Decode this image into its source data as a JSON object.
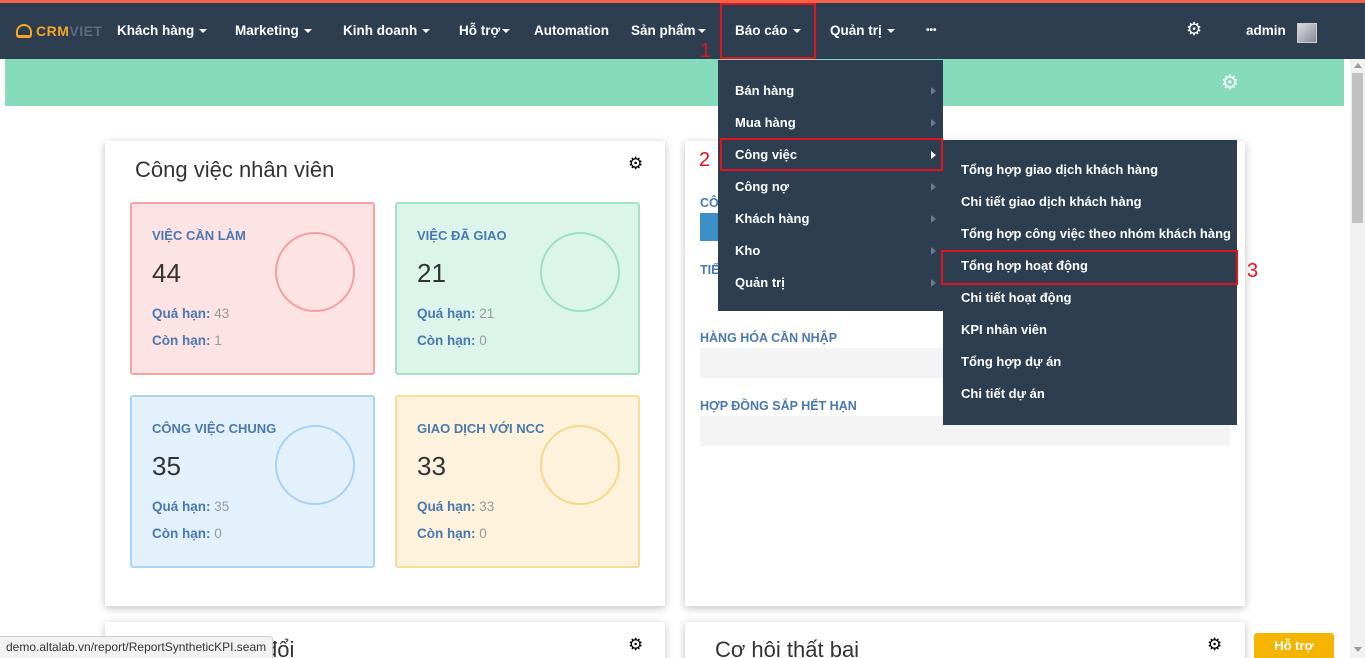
{
  "brand": {
    "logo_part1": "CRM",
    "logo_part2": "VIET"
  },
  "nav": {
    "khach_hang": "Khách hàng",
    "marketing": "Marketing",
    "kinh_doanh": "Kinh doanh",
    "ho_tro": "Hỗ trợ",
    "automation": "Automation",
    "san_pham": "Sản phẩm",
    "bao_cao": "Báo cáo",
    "quan_tri": "Quản trị",
    "more": "•••",
    "user": "admin"
  },
  "report_menu": {
    "items": [
      {
        "label": "Bán hàng"
      },
      {
        "label": "Mua hàng"
      },
      {
        "label": "Công việc"
      },
      {
        "label": "Công nợ"
      },
      {
        "label": "Khách hàng"
      },
      {
        "label": "Kho"
      },
      {
        "label": "Quản trị"
      }
    ]
  },
  "work_submenu": {
    "items": [
      {
        "label": "Tổng hợp giao dịch khách hàng"
      },
      {
        "label": "Chi tiết giao dịch khách hàng"
      },
      {
        "label": "Tổng hợp công việc theo nhóm khách hàng"
      },
      {
        "label": "Tổng hợp hoạt động"
      },
      {
        "label": "Chi tiết hoạt động"
      },
      {
        "label": "KPI nhân viên"
      },
      {
        "label": "Tổng hợp dự án"
      },
      {
        "label": "Chi tiết dự án"
      }
    ]
  },
  "annotations": {
    "step1": "1",
    "step2": "2",
    "step3": "3"
  },
  "work_panel": {
    "title": "Công việc nhân viên",
    "cards": [
      {
        "title": "VIỆC CẦN LÀM",
        "count": "44",
        "overdue_label": "Quá hạn:",
        "overdue": "43",
        "remaining_label": "Còn hạn:",
        "remaining": "1"
      },
      {
        "title": "VIỆC ĐÃ GIAO",
        "count": "21",
        "overdue_label": "Quá hạn:",
        "overdue": "21",
        "remaining_label": "Còn hạn:",
        "remaining": "0"
      },
      {
        "title": "CÔNG VIỆC CHUNG",
        "count": "35",
        "overdue_label": "Quá hạn:",
        "overdue": "35",
        "remaining_label": "Còn hạn:",
        "remaining": "0"
      },
      {
        "title": "GIAO DỊCH VỚI NCC",
        "count": "33",
        "overdue_label": "Quá hạn:",
        "overdue": "33",
        "remaining_label": "Còn hạn:",
        "remaining": "0"
      }
    ]
  },
  "right_panel": {
    "label_partial1": "CÔ",
    "label_partial2": "TIẾ",
    "goods_to_import": "HÀNG HÓA CẦN NHẬP",
    "expiring_contracts": "HỢP ĐỒNG SẮP HẾT HẠN"
  },
  "bottom": {
    "left_title_partial": "đổi",
    "right_title": "Cơ hội thất bại"
  },
  "status_url": "demo.altalab.vn/report/ReportSyntheticKPI.seam",
  "support_button": "Hỗ trợ"
}
